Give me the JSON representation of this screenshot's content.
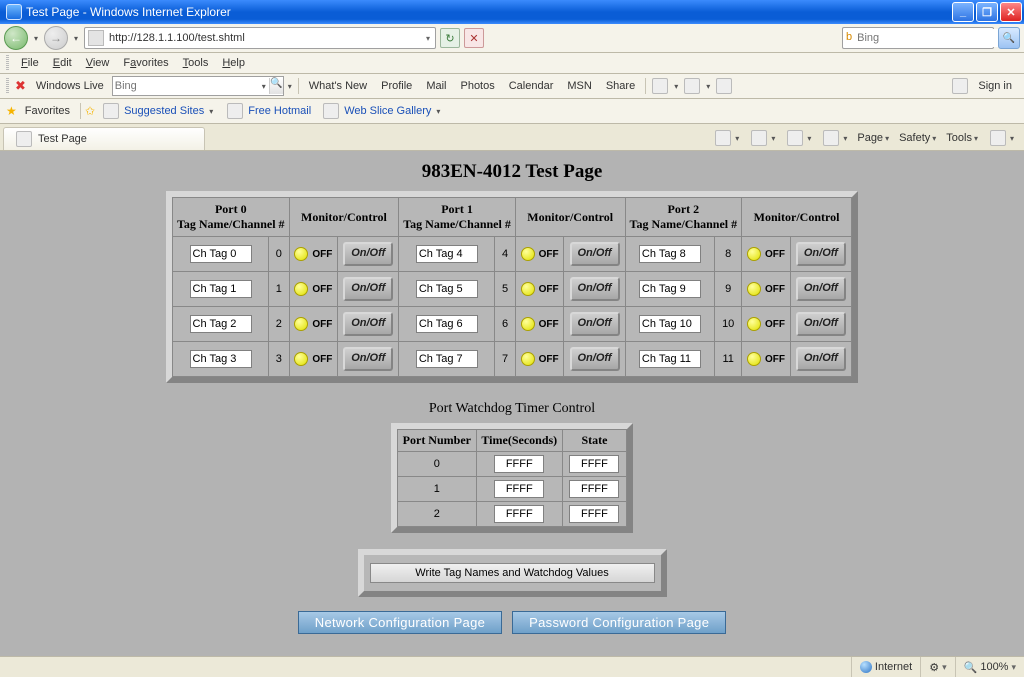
{
  "window": {
    "title": "Test Page - Windows Internet Explorer"
  },
  "nav": {
    "url": "http://128.1.1.100/test.shtml",
    "search_provider": "Bing"
  },
  "menu": {
    "file": "File",
    "edit": "Edit",
    "view": "View",
    "favorites": "Favorites",
    "tools": "Tools",
    "help": "Help"
  },
  "livebar": {
    "label": "Windows Live",
    "placeholder": "Bing",
    "whatsnew": "What's New",
    "profile": "Profile",
    "mail": "Mail",
    "photos": "Photos",
    "calendar": "Calendar",
    "msn": "MSN",
    "share": "Share",
    "signin": "Sign in"
  },
  "favbar": {
    "favorites": "Favorites",
    "suggested": "Suggested Sites",
    "freehotmail": "Free Hotmail",
    "webslice": "Web Slice Gallery"
  },
  "tab": {
    "label": "Test Page"
  },
  "cmdbar": {
    "page": "Page",
    "safety": "Safety",
    "tools": "Tools"
  },
  "page": {
    "title": "983EN-4012 Test Page",
    "watchdog_title": "Port Watchdog Timer Control",
    "write_button": "Write Tag Names and Watchdog Values",
    "link_network": "Network Configuration Page",
    "link_password": "Password Configuration Page"
  },
  "ports": {
    "headers": {
      "tag": "Tag Name/Channel #",
      "monitor": "Monitor/Control",
      "port0": "Port 0",
      "port1": "Port 1",
      "port2": "Port 2"
    },
    "off_label": "OFF",
    "onoff_label": "On/Off",
    "rows": [
      {
        "p0_tag": "Ch Tag 0",
        "p0_num": "0",
        "p1_tag": "Ch Tag 4",
        "p1_num": "4",
        "p2_tag": "Ch Tag 8",
        "p2_num": "8"
      },
      {
        "p0_tag": "Ch Tag 1",
        "p0_num": "1",
        "p1_tag": "Ch Tag 5",
        "p1_num": "5",
        "p2_tag": "Ch Tag 9",
        "p2_num": "9"
      },
      {
        "p0_tag": "Ch Tag 2",
        "p0_num": "2",
        "p1_tag": "Ch Tag 6",
        "p1_num": "6",
        "p2_tag": "Ch Tag 10",
        "p2_num": "10"
      },
      {
        "p0_tag": "Ch Tag 3",
        "p0_num": "3",
        "p1_tag": "Ch Tag 7",
        "p1_num": "7",
        "p2_tag": "Ch Tag 11",
        "p2_num": "11"
      }
    ]
  },
  "watchdog": {
    "headers": {
      "port": "Port Number",
      "time": "Time(Seconds)",
      "state": "State"
    },
    "rows": [
      {
        "port": "0",
        "time": "FFFF",
        "state": "FFFF"
      },
      {
        "port": "1",
        "time": "FFFF",
        "state": "FFFF"
      },
      {
        "port": "2",
        "time": "FFFF",
        "state": "FFFF"
      }
    ]
  },
  "status": {
    "zone": "Internet",
    "zoom": "100%"
  }
}
